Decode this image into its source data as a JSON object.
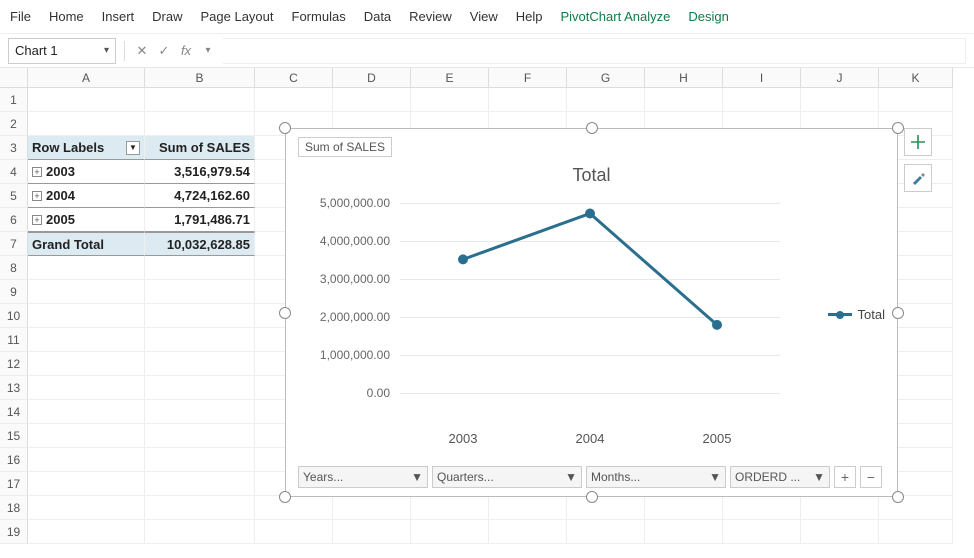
{
  "ribbon": {
    "items": [
      "File",
      "Home",
      "Insert",
      "Draw",
      "Page Layout",
      "Formulas",
      "Data",
      "Review",
      "View",
      "Help",
      "PivotChart Analyze",
      "Design"
    ],
    "green_indices": [
      10,
      11
    ]
  },
  "namebox": {
    "value": "Chart 1"
  },
  "formula_bar": {
    "fx_label": "fx",
    "value": ""
  },
  "columns": [
    "A",
    "B",
    "C",
    "D",
    "E",
    "F",
    "G",
    "H",
    "I",
    "J",
    "K"
  ],
  "row_numbers": [
    "1",
    "2",
    "3",
    "4",
    "5",
    "6",
    "7",
    "8",
    "9",
    "10",
    "11",
    "12",
    "13",
    "14",
    "15",
    "16",
    "17",
    "18",
    "19"
  ],
  "pivot": {
    "header": {
      "row_labels": "Row Labels",
      "value_col": "Sum of SALES"
    },
    "rows": [
      {
        "label": "2003",
        "value": "3,516,979.54"
      },
      {
        "label": "2004",
        "value": "4,724,162.60"
      },
      {
        "label": "2005",
        "value": "1,791,486.71"
      }
    ],
    "grand": {
      "label": "Grand Total",
      "value": "10,032,628.85"
    }
  },
  "chart": {
    "field_title": "Sum of SALES",
    "title": "Total",
    "legend": "Total",
    "yticks": [
      "5,000,000.00",
      "4,000,000.00",
      "3,000,000.00",
      "2,000,000.00",
      "1,000,000.00",
      "0.00"
    ],
    "xlabels": [
      "2003",
      "2004",
      "2005"
    ],
    "filters": [
      "Years...",
      "Quarters...",
      "Months...",
      "ORDERD ..."
    ],
    "side_buttons": {
      "plus": "+",
      "brush": "brush"
    }
  },
  "chart_data": {
    "type": "line",
    "title": "Total",
    "ylabel": "Sum of SALES",
    "ylim": [
      0,
      5000000
    ],
    "categories": [
      "2003",
      "2004",
      "2005"
    ],
    "series": [
      {
        "name": "Total",
        "values": [
          3516979.54,
          4724162.6,
          1791486.71
        ]
      }
    ]
  }
}
